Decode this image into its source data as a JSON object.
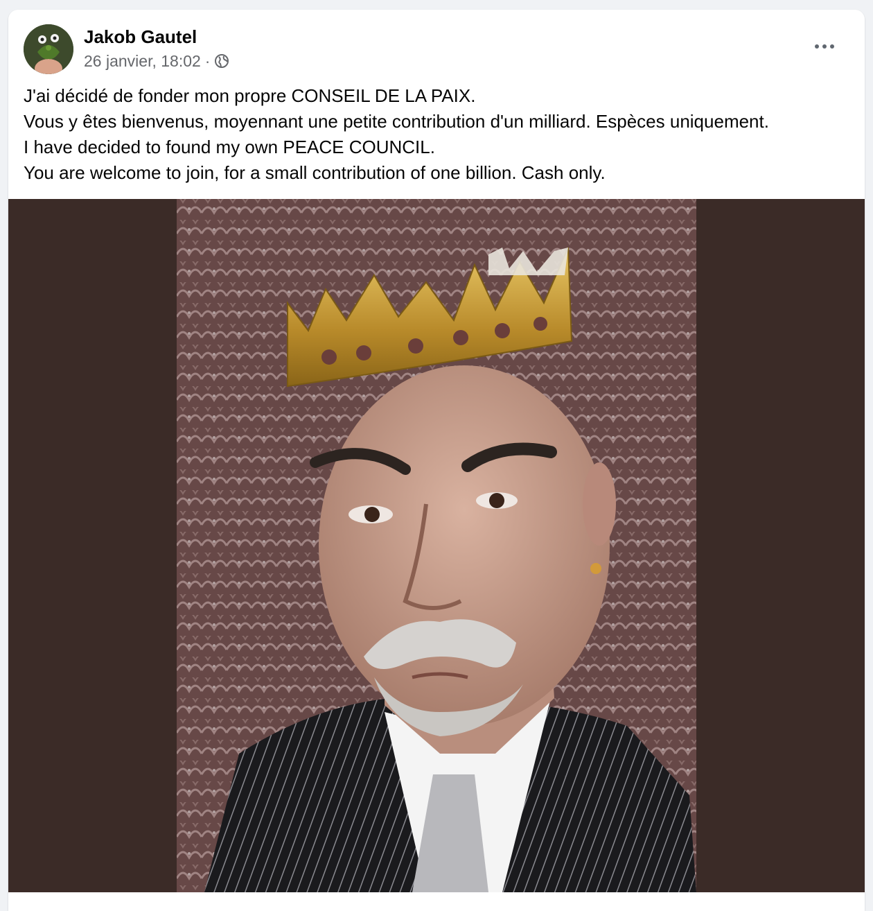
{
  "post": {
    "author": "Jakob Gautel",
    "timestamp": "26 janvier, 18:02",
    "separator": "·",
    "privacy_icon": "globe-icon",
    "more_icon": "more-options-icon",
    "lines": [
      "J'ai décidé de fonder mon propre CONSEIL DE LA PAIX.",
      "Vous y êtes bienvenus, moyennant une petite contribution d'un milliard. Espèces uniquement.",
      "I have decided to found my own PEACE COUNCIL.",
      "You are welcome to join, for a small contribution of one billion. Cash only."
    ]
  },
  "colors": {
    "page_bg": "#f0f2f5",
    "card_bg": "#ffffff",
    "secondary_text": "#65676b",
    "photo_letterbox": "#3b2b27"
  }
}
